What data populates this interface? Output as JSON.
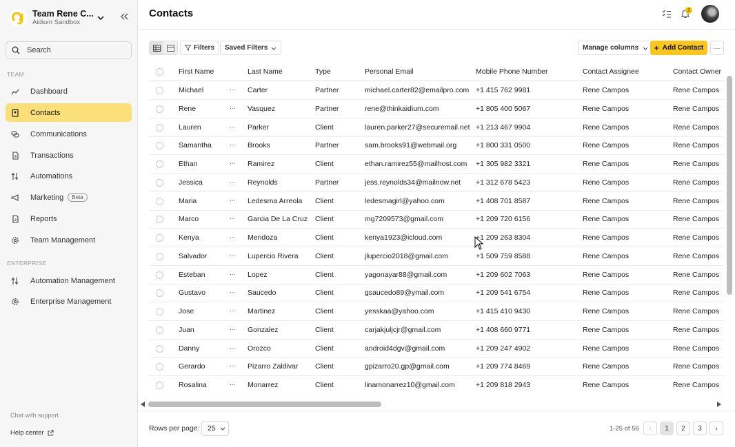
{
  "colors": {
    "accent": "#f8c61c",
    "active_nav": "#fbe07a"
  },
  "team": {
    "name": "Team Rene C...",
    "sandbox": "Aidium Sandbox"
  },
  "search": {
    "label": "Search"
  },
  "sections": {
    "team": "TEAM",
    "enterprise": "ENTERPRISE"
  },
  "nav": {
    "dashboard": "Dashboard",
    "contacts": "Contacts",
    "communications": "Communications",
    "transactions": "Transactions",
    "automations": "Automations",
    "marketing": "Marketing",
    "marketing_badge": "Beta",
    "reports": "Reports",
    "team_management": "Team Management",
    "automation_management": "Automation Management",
    "enterprise_management": "Enterprise Management"
  },
  "sidebar_footer": {
    "chat": "Chat with support",
    "help": "Help center"
  },
  "header": {
    "title": "Contacts",
    "notification_count": "2"
  },
  "toolbar": {
    "filters": "Filters",
    "saved_filters": "Saved Filters",
    "manage_columns": "Manage columns",
    "add_contact": "Add Contact",
    "more": "···"
  },
  "table": {
    "columns": [
      "First Name",
      "Last Name",
      "Type",
      "Personal Email",
      "Mobile Phone Number",
      "Contact Assignee",
      "Contact Owner"
    ],
    "rows": [
      [
        "Michael",
        "Carter",
        "Partner",
        "michael.carter82@emailpro.com",
        "+1 415 762 9981",
        "Rene Campos",
        "Rene Campos"
      ],
      [
        "Rene",
        "Vasquez",
        "Partner",
        "rene@thinkaidium.com",
        "+1 805 400 5067",
        "Rene Campos",
        "Rene Campos"
      ],
      [
        "Lauren",
        "Parker",
        "Client",
        "lauren.parker27@securemail.net",
        "+1 213 467 9904",
        "Rene Campos",
        "Rene Campos"
      ],
      [
        "Samantha",
        "Brooks",
        "Partner",
        "sam.brooks91@webmail.org",
        "+1 800 331 0500",
        "Rene Campos",
        "Rene Campos"
      ],
      [
        "Ethan",
        "Ramirez",
        "Client",
        "ethan.ramirez55@mailhost.com",
        "+1 305 982 3321",
        "Rene Campos",
        "Rene Campos"
      ],
      [
        "Jessica",
        "Reynolds",
        "Partner",
        "jess.reynolds34@mailnow.net",
        "+1 312 678 5423",
        "Rene Campos",
        "Rene Campos"
      ],
      [
        "Maria",
        "Ledesma Arreola",
        "Client",
        "ledesmagirl@yahoo.com",
        "+1 408 701 8587",
        "Rene Campos",
        "Rene Campos"
      ],
      [
        "Marco",
        "Garcia De La Cruz",
        "Client",
        "mg7209573@gmail.com",
        "+1 209 720 6156",
        "Rene Campos",
        "Rene Campos"
      ],
      [
        "Kenya",
        "Mendoza",
        "Client",
        "kenya1923@icloud.com",
        "+1 209 263 8304",
        "Rene Campos",
        "Rene Campos"
      ],
      [
        "Salvador",
        "Lupercio Rivera",
        "Client",
        "jlupercio2018@gmail.com",
        "+1 509 759 8588",
        "Rene Campos",
        "Rene Campos"
      ],
      [
        "Esteban",
        "Lopez",
        "Client",
        "yagonayar88@gmail.com",
        "+1 209 602 7063",
        "Rene Campos",
        "Rene Campos"
      ],
      [
        "Gustavo",
        "Saucedo",
        "Client",
        "gsaucedo89@ymail.com",
        "+1 209 541 6754",
        "Rene Campos",
        "Rene Campos"
      ],
      [
        "Jose",
        "Martinez",
        "Client",
        "yesskaa@yahoo.com",
        "+1 415 410 9430",
        "Rene Campos",
        "Rene Campos"
      ],
      [
        "Juan",
        "Gonzalez",
        "Client",
        "carjakjuljcjr@gmail.com",
        "+1 408 660 9771",
        "Rene Campos",
        "Rene Campos"
      ],
      [
        "Danny",
        "Orozco",
        "Client",
        "android4dgv@gmail.com",
        "+1 209 247 4902",
        "Rene Campos",
        "Rene Campos"
      ],
      [
        "Gerardo",
        "Pizarro Zaldivar",
        "Client",
        "gpizarro20.gp@gmail.com",
        "+1 209 774 8469",
        "Rene Campos",
        "Rene Campos"
      ],
      [
        "Rosalina",
        "Monarrez",
        "Client",
        "linamonarrez10@gmail.com",
        "+1 209 818 2943",
        "Rene Campos",
        "Rene Campos"
      ]
    ],
    "row_menu": "···"
  },
  "footer": {
    "rows_per_page_label": "Rows per page:",
    "rows_per_page_value": "25",
    "range": "1-25 of 56",
    "pages": [
      "1",
      "2",
      "3"
    ],
    "prev": "‹",
    "next": "›"
  }
}
